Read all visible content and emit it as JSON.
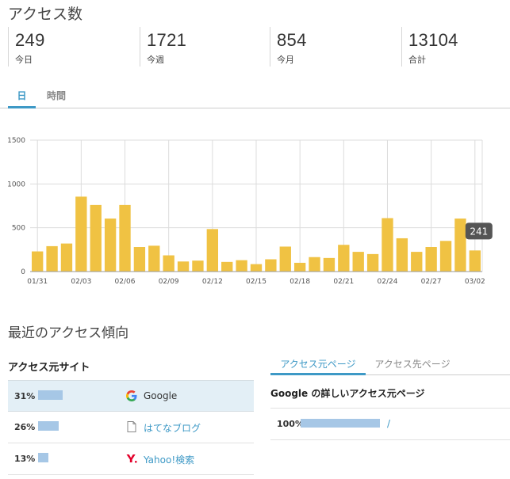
{
  "header": {
    "title": "アクセス数"
  },
  "stats": [
    {
      "value": "249",
      "label": "今日"
    },
    {
      "value": "1721",
      "label": "今週"
    },
    {
      "value": "854",
      "label": "今月"
    },
    {
      "value": "13104",
      "label": "合計"
    }
  ],
  "period_tabs": [
    {
      "label": "日",
      "active": true
    },
    {
      "label": "時間",
      "active": false
    }
  ],
  "chart_data": {
    "type": "bar",
    "categories": [
      "01/31",
      "02/01",
      "02/02",
      "02/03",
      "02/04",
      "02/05",
      "02/06",
      "02/07",
      "02/08",
      "02/09",
      "02/10",
      "02/11",
      "02/12",
      "02/13",
      "02/14",
      "02/15",
      "02/16",
      "02/17",
      "02/18",
      "02/19",
      "02/20",
      "02/21",
      "02/22",
      "02/23",
      "02/24",
      "02/25",
      "02/26",
      "02/27",
      "02/28",
      "03/01",
      "03/02"
    ],
    "tick_labels": [
      "01/31",
      "02/03",
      "02/06",
      "02/09",
      "02/12",
      "02/15",
      "02/18",
      "02/21",
      "02/24",
      "02/27",
      "03/02"
    ],
    "values": [
      230,
      290,
      320,
      855,
      760,
      605,
      760,
      280,
      295,
      185,
      115,
      125,
      485,
      110,
      130,
      85,
      140,
      285,
      100,
      165,
      155,
      305,
      225,
      200,
      610,
      380,
      225,
      280,
      350,
      605,
      241
    ],
    "ylim": [
      0,
      1500
    ],
    "yticks": [
      0,
      500,
      1000,
      1500
    ],
    "bar_color": "#f0c243",
    "tooltip": {
      "index": 30,
      "value": "241"
    },
    "grid": true
  },
  "trend": {
    "title": "最近のアクセス傾向"
  },
  "sources": {
    "heading": "アクセス元サイト",
    "rows": [
      {
        "percent": "31%",
        "value": 31,
        "icon": "google-icon",
        "site": "Google",
        "link": false
      },
      {
        "percent": "26%",
        "value": 26,
        "icon": "page-icon",
        "site": "はてなブログ",
        "link": true
      },
      {
        "percent": "13%",
        "value": 13,
        "icon": "yahoo-icon",
        "site": "Yahoo!検索",
        "link": true
      }
    ]
  },
  "page_tabs": [
    {
      "label": "アクセス元ページ",
      "active": true
    },
    {
      "label": "アクセス先ページ",
      "active": false
    }
  ],
  "detail": {
    "heading": "Google の詳しいアクセス元ページ",
    "rows": [
      {
        "percent": "100%",
        "value": 100,
        "path": "/"
      }
    ]
  },
  "colors": {
    "accent": "#3e99c6",
    "bar": "#f0c243",
    "source_bar": "#a6c7e6"
  }
}
